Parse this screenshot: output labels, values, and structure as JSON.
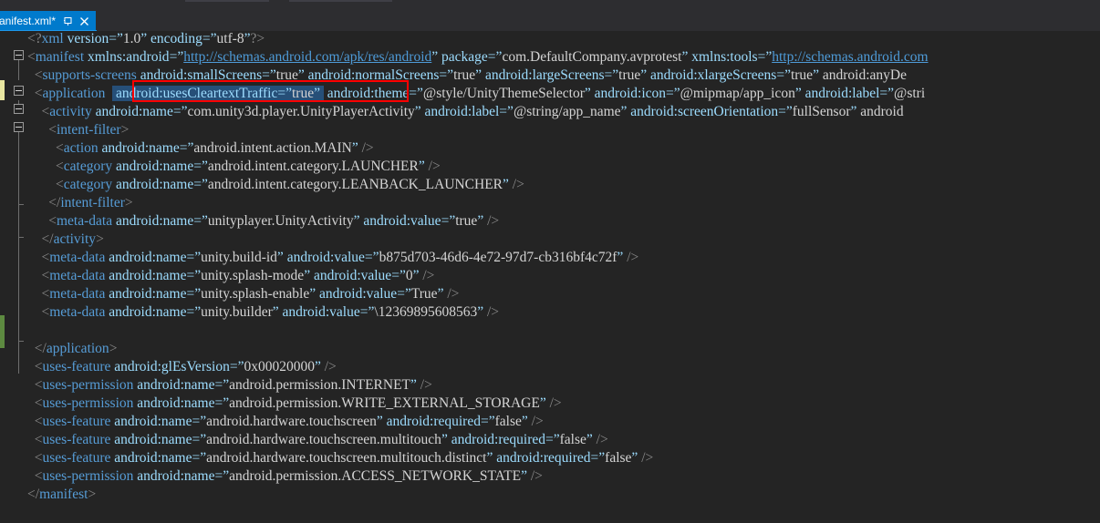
{
  "window": {
    "background_color": "#242424",
    "tabbar_color": "#2d2d30",
    "accent_color": "#007acc"
  },
  "tab": {
    "title": "anifest.xml*",
    "pin_icon": "pin-icon",
    "close_icon": "close-icon",
    "active": true
  },
  "annotation": {
    "type": "red-rectangle",
    "color": "#ff0000",
    "target_text": "android:usesCleartextTraffic=\"true\""
  },
  "selection": {
    "color": "#264f78",
    "text": "android:usesCleartextTraffic=\"true\""
  },
  "gutter": {
    "change_bar_modified_color": "#e8e6a0",
    "change_bar_saved_color": "#5d8a40",
    "fold_icons": [
      "collapse-icon",
      "collapse-icon",
      "collapse-icon",
      "collapse-icon"
    ]
  },
  "code": {
    "language": "xml",
    "lines": [
      "<?xml version=\"1.0\" encoding=\"utf-8\"?>",
      "<manifest xmlns:android=\"http://schemas.android.com/apk/res/android\" package=\"com.DefaultCompany.avprotest\" xmlns:tools=\"http://schemas.android.com",
      "  <supports-screens android:smallScreens=\"true\" android:normalScreens=\"true\" android:largeScreens=\"true\" android:xlargeScreens=\"true\" android:anyDe",
      "  <application  android:usesCleartextTraffic=\"true\" android:theme=\"@style/UnityThemeSelector\" android:icon=\"@mipmap/app_icon\" android:label=\"@stri",
      "    <activity android:name=\"com.unity3d.player.UnityPlayerActivity\" android:label=\"@string/app_name\" android:screenOrientation=\"fullSensor\" android",
      "      <intent-filter>",
      "        <action android:name=\"android.intent.action.MAIN\" />",
      "        <category android:name=\"android.intent.category.LAUNCHER\" />",
      "        <category android:name=\"android.intent.category.LEANBACK_LAUNCHER\" />",
      "      </intent-filter>",
      "      <meta-data android:name=\"unityplayer.UnityActivity\" android:value=\"true\" />",
      "    </activity>",
      "    <meta-data android:name=\"unity.build-id\" android:value=\"b875d703-46d6-4e72-97d7-cb316bf4c72f\" />",
      "    <meta-data android:name=\"unity.splash-mode\" android:value=\"0\" />",
      "    <meta-data android:name=\"unity.splash-enable\" android:value=\"True\" />",
      "    <meta-data android:name=\"unity.builder\" android:value=\"\\12369895608563\" />",
      "",
      "  </application>",
      "  <uses-feature android:glEsVersion=\"0x00020000\" />",
      "  <uses-permission android:name=\"android.permission.INTERNET\" />",
      "  <uses-permission android:name=\"android.permission.WRITE_EXTERNAL_STORAGE\" />",
      "  <uses-feature android:name=\"android.hardware.touchscreen\" android:required=\"false\" />",
      "  <uses-feature android:name=\"android.hardware.touchscreen.multitouch\" android:required=\"false\" />",
      "  <uses-feature android:name=\"android.hardware.touchscreen.multitouch.distinct\" android:required=\"false\" />",
      "  <uses-permission android:name=\"android.permission.ACCESS_NETWORK_STATE\" />",
      "</manifest>"
    ]
  }
}
